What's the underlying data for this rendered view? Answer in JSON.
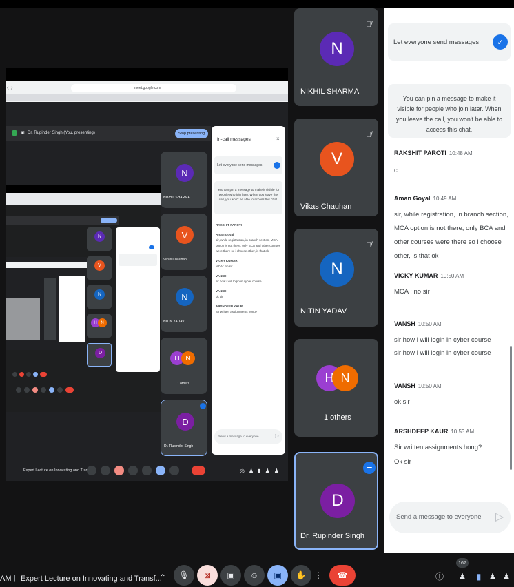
{
  "participants": [
    {
      "name": "NIKHIL SHARMA",
      "initial": "N",
      "color": "#5b2ab5"
    },
    {
      "name": "Vikas Chauhan",
      "initial": "V",
      "color": "#e8541e"
    },
    {
      "name": "NITIN YADAV",
      "initial": "N",
      "color": "#1565c0"
    },
    {
      "name": "1 others",
      "initials": [
        "H",
        "N"
      ],
      "colors": [
        "#9b3fd1",
        "#ef6c00"
      ]
    },
    {
      "name": "Dr. Rupinder Singh",
      "initial": "D",
      "color": "#7b1fa2"
    }
  ],
  "others_count": "1 others",
  "chat": {
    "toggle_label": "Let everyone send messages",
    "info": "You can pin a message to make it visible for people who join later. When you leave the call, you won't be able to access this chat.",
    "messages": [
      {
        "name": "RAKSHIT PAROTI",
        "time": "10:48 AM",
        "lines": [
          "c"
        ]
      },
      {
        "name": "Aman Goyal",
        "time": "10:49 AM",
        "lines": [
          "sir, while registration, in branch section, MCA option is not there, only BCA and other courses were there so i choose other, is that ok"
        ]
      },
      {
        "name": "VICKY KUMAR",
        "time": "10:50 AM",
        "lines": [
          "MCA : no sir"
        ]
      },
      {
        "name": "VANSH",
        "time": "10:50 AM",
        "lines": [
          "sir how i will login in cyber course",
          "sir how i will login in cyber course"
        ]
      },
      {
        "name": "VANSH",
        "time": "10:50 AM",
        "lines": [
          "ok sir"
        ]
      },
      {
        "name": "ARSHDEEP KAUR",
        "time": "10:53 AM",
        "lines": [
          "Sir written assignments hong?",
          "Ok sir"
        ]
      }
    ],
    "input_placeholder": "Send a message to everyone"
  },
  "bottom": {
    "time": "AM",
    "meeting_title": "Expert Lecture on Innovating and Transf...",
    "participant_badge": "167"
  },
  "nested": {
    "presenting_label": "Dr. Rupinder Singh (You, presenting)",
    "stop_presenting": "Stop presenting",
    "url": "meet.google.com",
    "chat_title": "In-call messages",
    "toggle_label": "Let everyone send messages",
    "info": "You can pin a message to make it visible for people who join later. When you leave the call, you won't be able to access this chat.",
    "input_placeholder": "Send a message to everyone",
    "meeting_title": "Expert Lecture on Innovating and Transf..."
  },
  "colors": {
    "accent": "#1a73e8",
    "end_call": "#ea4335",
    "tile": "#3c4043",
    "bg": "#131314"
  }
}
